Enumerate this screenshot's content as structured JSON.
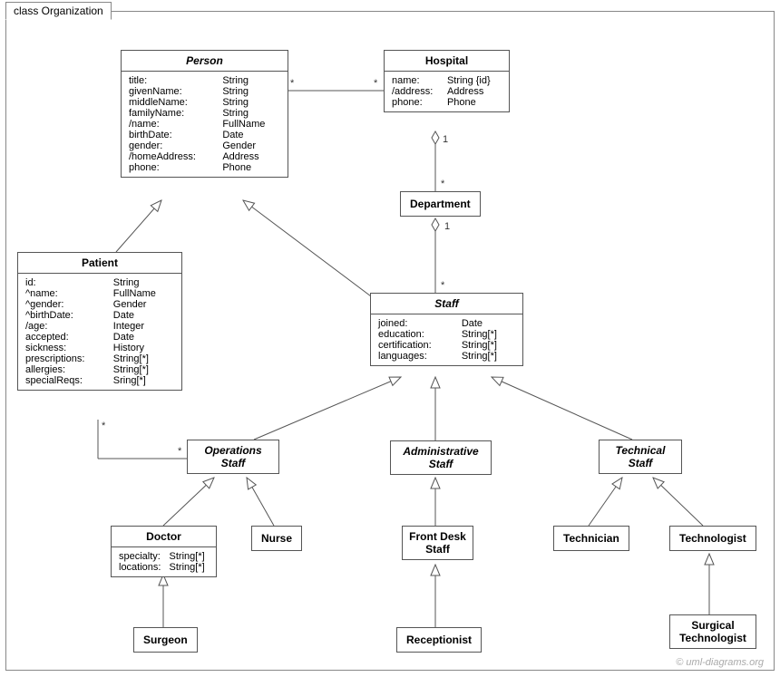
{
  "frame": {
    "title": "class Organization"
  },
  "classes": {
    "person": {
      "name": "Person",
      "attrs": [
        [
          "title:",
          "String"
        ],
        [
          "givenName:",
          "String"
        ],
        [
          "middleName:",
          "String"
        ],
        [
          "familyName:",
          "String"
        ],
        [
          "/name:",
          "FullName"
        ],
        [
          "birthDate:",
          "Date"
        ],
        [
          "gender:",
          "Gender"
        ],
        [
          "/homeAddress:",
          "Address"
        ],
        [
          "phone:",
          "Phone"
        ]
      ]
    },
    "hospital": {
      "name": "Hospital",
      "attrs": [
        [
          "name:",
          "String {id}"
        ],
        [
          "/address:",
          "Address"
        ],
        [
          "phone:",
          "Phone"
        ]
      ]
    },
    "department": {
      "name": "Department"
    },
    "patient": {
      "name": "Patient",
      "attrs": [
        [
          "id:",
          "String"
        ],
        [
          "^name:",
          "FullName"
        ],
        [
          "^gender:",
          "Gender"
        ],
        [
          "^birthDate:",
          "Date"
        ],
        [
          "/age:",
          "Integer"
        ],
        [
          "accepted:",
          "Date"
        ],
        [
          "sickness:",
          "History"
        ],
        [
          "prescriptions:",
          "String[*]"
        ],
        [
          "allergies:",
          "String[*]"
        ],
        [
          "specialReqs:",
          "Sring[*]"
        ]
      ]
    },
    "staff": {
      "name": "Staff",
      "attrs": [
        [
          "joined:",
          "Date"
        ],
        [
          "education:",
          "String[*]"
        ],
        [
          "certification:",
          "String[*]"
        ],
        [
          "languages:",
          "String[*]"
        ]
      ]
    },
    "opsStaff": {
      "name1": "Operations",
      "name2": "Staff"
    },
    "adminStaff": {
      "name1": "Administrative",
      "name2": "Staff"
    },
    "techStaff": {
      "name1": "Technical",
      "name2": "Staff"
    },
    "doctor": {
      "name": "Doctor",
      "attrs": [
        [
          "specialty:",
          "String[*]"
        ],
        [
          "locations:",
          "String[*]"
        ]
      ]
    },
    "nurse": {
      "name": "Nurse"
    },
    "frontDesk": {
      "name1": "Front Desk",
      "name2": "Staff"
    },
    "technician": {
      "name": "Technician"
    },
    "technologist": {
      "name": "Technologist"
    },
    "surgeon": {
      "name": "Surgeon"
    },
    "receptionist": {
      "name": "Receptionist"
    },
    "surgTech": {
      "name1": "Surgical",
      "name2": "Technologist"
    }
  },
  "mult": {
    "personHospL": "*",
    "personHospR": "*",
    "hospDeptTop": "1",
    "hospDeptBot": "*",
    "deptStaffTop": "1",
    "deptStaffBot": "*",
    "patientOpsL": "*",
    "patientOpsR": "*"
  },
  "watermark": "© uml-diagrams.org"
}
